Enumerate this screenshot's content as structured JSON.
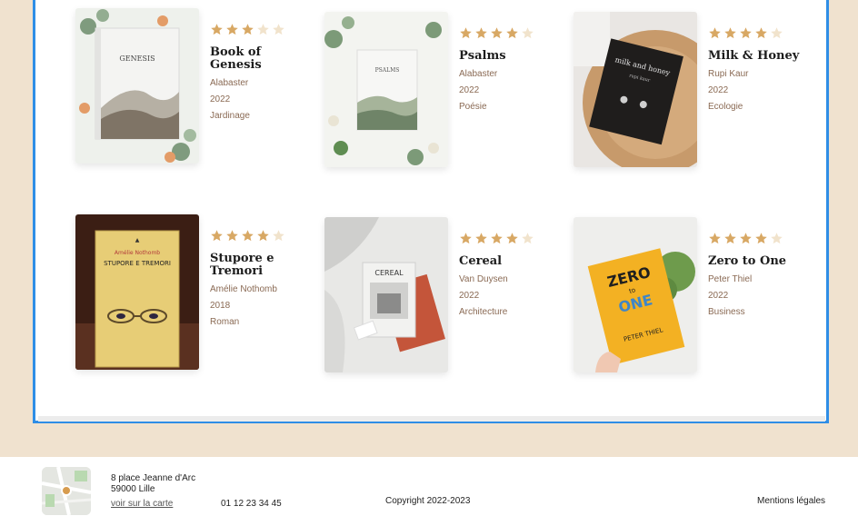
{
  "colors": {
    "page_bg": "#f0e2cf",
    "panel_border": "#2f8ee6",
    "star_filled": "#d8a864",
    "star_empty": "#f1e3cc",
    "meta_text": "#8a6a54"
  },
  "books": [
    {
      "title": "Book of Genesis",
      "author": "Alabaster",
      "year": "2022",
      "category": "Jardinage",
      "rating": 3,
      "max_rating": 5
    },
    {
      "title": "Psalms",
      "author": "Alabaster",
      "year": "2022",
      "category": "Poésie",
      "rating": 4,
      "max_rating": 5
    },
    {
      "title": "Milk & Honey",
      "author": "Rupi Kaur",
      "year": "2022",
      "category": "Ecologie",
      "rating": 4,
      "max_rating": 5
    },
    {
      "title": "Stupore e Tremori",
      "author": "Amélie Nothomb",
      "year": "2018",
      "category": "Roman",
      "rating": 4,
      "max_rating": 5
    },
    {
      "title": "Cereal",
      "author": "Van Duysen",
      "year": "2022",
      "category": "Architecture",
      "rating": 4,
      "max_rating": 5
    },
    {
      "title": "Zero to One",
      "author": "Peter Thiel",
      "year": "2022",
      "category": "Business",
      "rating": 4,
      "max_rating": 5
    }
  ],
  "covers": {
    "genesis": "GENESIS",
    "psalms": "PSALMS",
    "milk_honey_title": "milk and honey",
    "milk_honey_author": "rupi kaur",
    "stupore_author": "Amélie Nothomb",
    "stupore_title": "STUPORE E TREMORI",
    "cereal": "CEREAL",
    "zero_line1": "ZERO",
    "zero_line2": "to",
    "zero_line3": "ONE",
    "zero_author": "PETER THIEL"
  },
  "footer": {
    "address_line1": "8 place Jeanne d'Arc",
    "address_line2": "59000 Lille",
    "map_link": "voir sur la carte",
    "phone": "01 12 23 34 45",
    "copyright": "Copyright 2022-2023",
    "legal": "Mentions légales"
  }
}
